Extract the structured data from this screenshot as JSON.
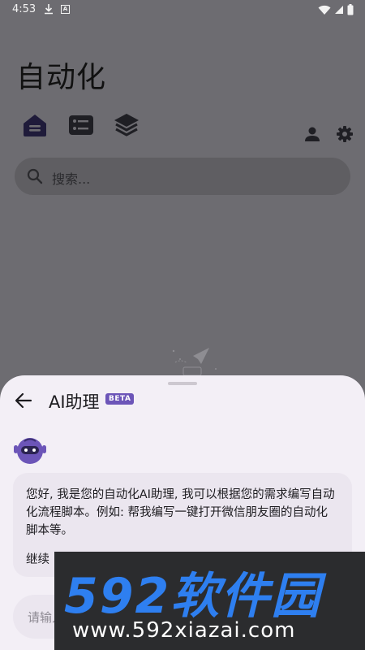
{
  "status_bar": {
    "time": "4:53",
    "a_icon_label": "A"
  },
  "app": {
    "title": "自动化",
    "search": {
      "placeholder": "搜索..."
    }
  },
  "sheet": {
    "title": "AI助理",
    "badge": "BETA",
    "message_paragraph1": "您好, 我是您的自动化AI助理, 我可以根据您的需求编写自动化流程脚本。例如: 帮我编写一键打开微信朋友圈的自动化脚本等。",
    "message_paragraph2": "继续",
    "input_placeholder": "请输入"
  },
  "watermark": {
    "logo": "592软件园",
    "url": "www.592xiazai.com"
  },
  "colors": {
    "scrim": "#6d6c71",
    "sheet_bg": "#f3eff6",
    "accent": "#6c55b8",
    "icon_dark": "#1f1b3a"
  }
}
